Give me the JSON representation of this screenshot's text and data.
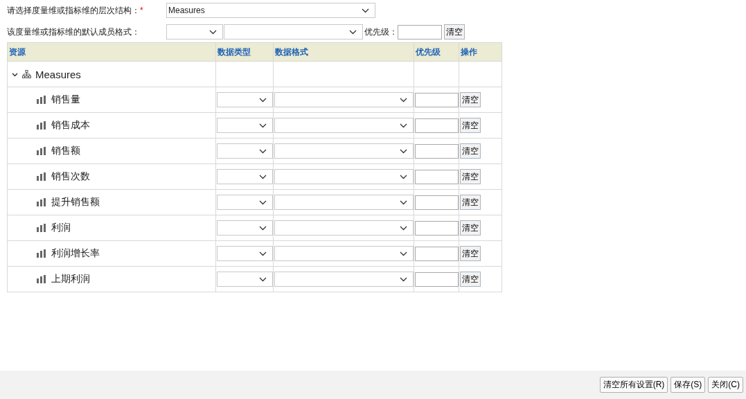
{
  "form": {
    "hierarchy": {
      "label": "请选择度量维或指标维的层次结构：",
      "required_mark": "*",
      "value": "Measures"
    },
    "default_format": {
      "label": "该度量维或指标维的默认成员格式：",
      "priority_label": "优先级：",
      "clear_button": "清空"
    }
  },
  "table": {
    "columns": [
      "资源",
      "数据类型",
      "数据格式",
      "优先级",
      "操作"
    ],
    "root": {
      "label": "Measures",
      "expanded": true,
      "children": [
        {
          "label": "销售量",
          "clear_button": "清空"
        },
        {
          "label": "销售成本",
          "clear_button": "清空"
        },
        {
          "label": "销售额",
          "clear_button": "清空"
        },
        {
          "label": "销售次数",
          "clear_button": "清空"
        },
        {
          "label": "提升销售额",
          "clear_button": "清空"
        },
        {
          "label": "利润",
          "clear_button": "清空"
        },
        {
          "label": "利润增长率",
          "clear_button": "清空"
        },
        {
          "label": "上期利润",
          "clear_button": "清空"
        }
      ]
    }
  },
  "footer": {
    "buttons": [
      "清空所有设置(R)",
      "保存(S)",
      "关闭(C)"
    ]
  }
}
